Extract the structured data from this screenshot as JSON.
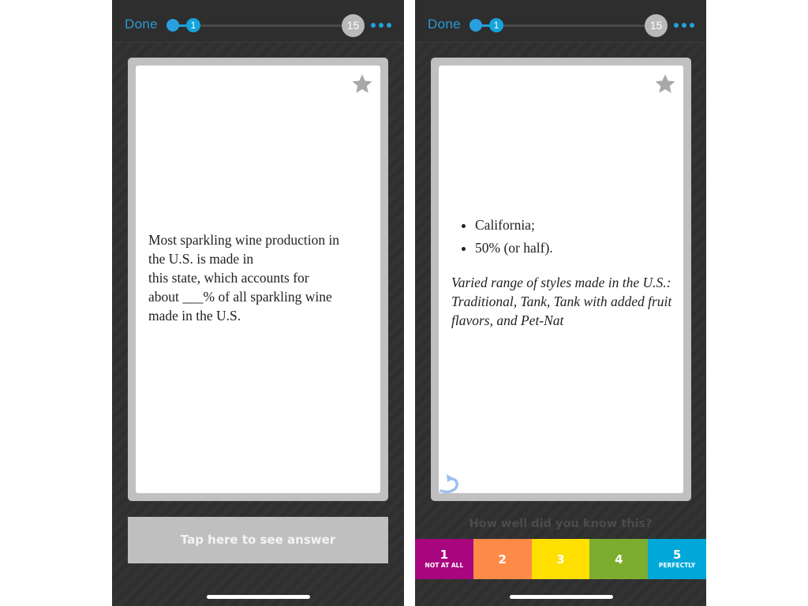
{
  "header": {
    "done_label": "Done",
    "current_card": "1",
    "total_cards": "15",
    "more_icon": "more-dots-icon"
  },
  "colors": {
    "accent": "#1ea3dd",
    "card_frame": "#c0c0c0",
    "button_gray": "#bfbfbf",
    "star_gray": "#a8a8a8"
  },
  "front": {
    "question_lines": [
      "Most sparkling wine production in",
      "the U.S. is made in",
      "this state, which accounts for",
      "about ___% of all sparkling wine",
      "made in the U.S."
    ],
    "see_answer_label": "Tap here to see answer",
    "star_icon": "star-icon"
  },
  "back": {
    "answer_items": [
      "California;",
      "50% (or half)."
    ],
    "note": "Varied range of styles made in the U.S.: Traditional, Tank, Tank with added fruit flavors, and Pet-Nat",
    "flip_icon": "flip-back-icon",
    "rating_prompt": "How well did you know this?",
    "ratings": [
      {
        "value": "1",
        "label": "NOT AT ALL",
        "color": "#a7067f"
      },
      {
        "value": "2",
        "label": "",
        "color": "#fe8a47"
      },
      {
        "value": "3",
        "label": "",
        "color": "#fedf00"
      },
      {
        "value": "4",
        "label": "",
        "color": "#7cad2f"
      },
      {
        "value": "5",
        "label": "PERFECTLY",
        "color": "#00a8da"
      }
    ]
  }
}
